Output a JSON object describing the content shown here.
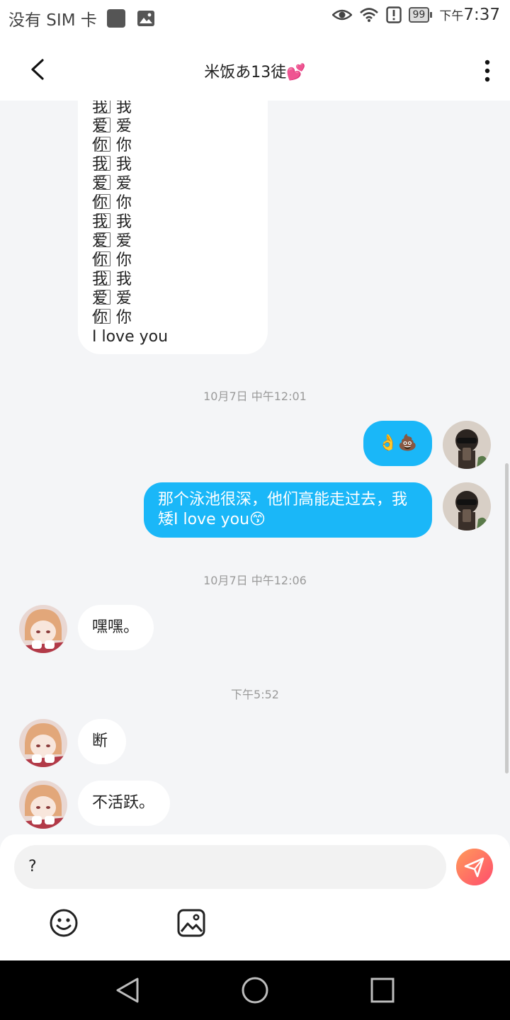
{
  "status_bar": {
    "carrier": "没有 SIM 卡",
    "battery": "99",
    "time_prefix": "下午",
    "time": "7:37"
  },
  "header": {
    "title": "米饭あ13徒💕"
  },
  "messages": {
    "poem_lines": [
      "我 ⃞ 我",
      "爱 ⃞ 爱",
      "你 ⃞ 你",
      "我 ⃞ 我",
      "爱 ⃞ 爱",
      "你 ⃞ 你",
      "我 ⃞ 我",
      "爱 ⃞ 爱",
      "你 ⃞ 你",
      "我 ⃞ 我",
      "爱 ⃞ 爱",
      "你 ⃞ 你"
    ],
    "poem_tail": "I love you",
    "ts1": "10月7日 中午12:01",
    "out1": "👌💩",
    "out2_line1": "那个泳池很深，他们高能走过去，我",
    "out2_line2": "矮I love you😙",
    "ts2": "10月7日 中午12:06",
    "in1": "嘿嘿。",
    "ts3": "下午5:52",
    "in2": "断",
    "in3": "不活跃。"
  },
  "composer": {
    "input_value": "?"
  },
  "icons": {
    "back": "chevron-left-icon",
    "more": "more-vertical-icon",
    "send": "send-icon",
    "emoji": "emoji-icon",
    "image": "image-icon"
  },
  "colors": {
    "outgoing_bubble": "#1ab7f8",
    "background": "#f4f5f7",
    "send_gradient_start": "#ff9b5a",
    "send_gradient_end": "#ff4d6d"
  }
}
